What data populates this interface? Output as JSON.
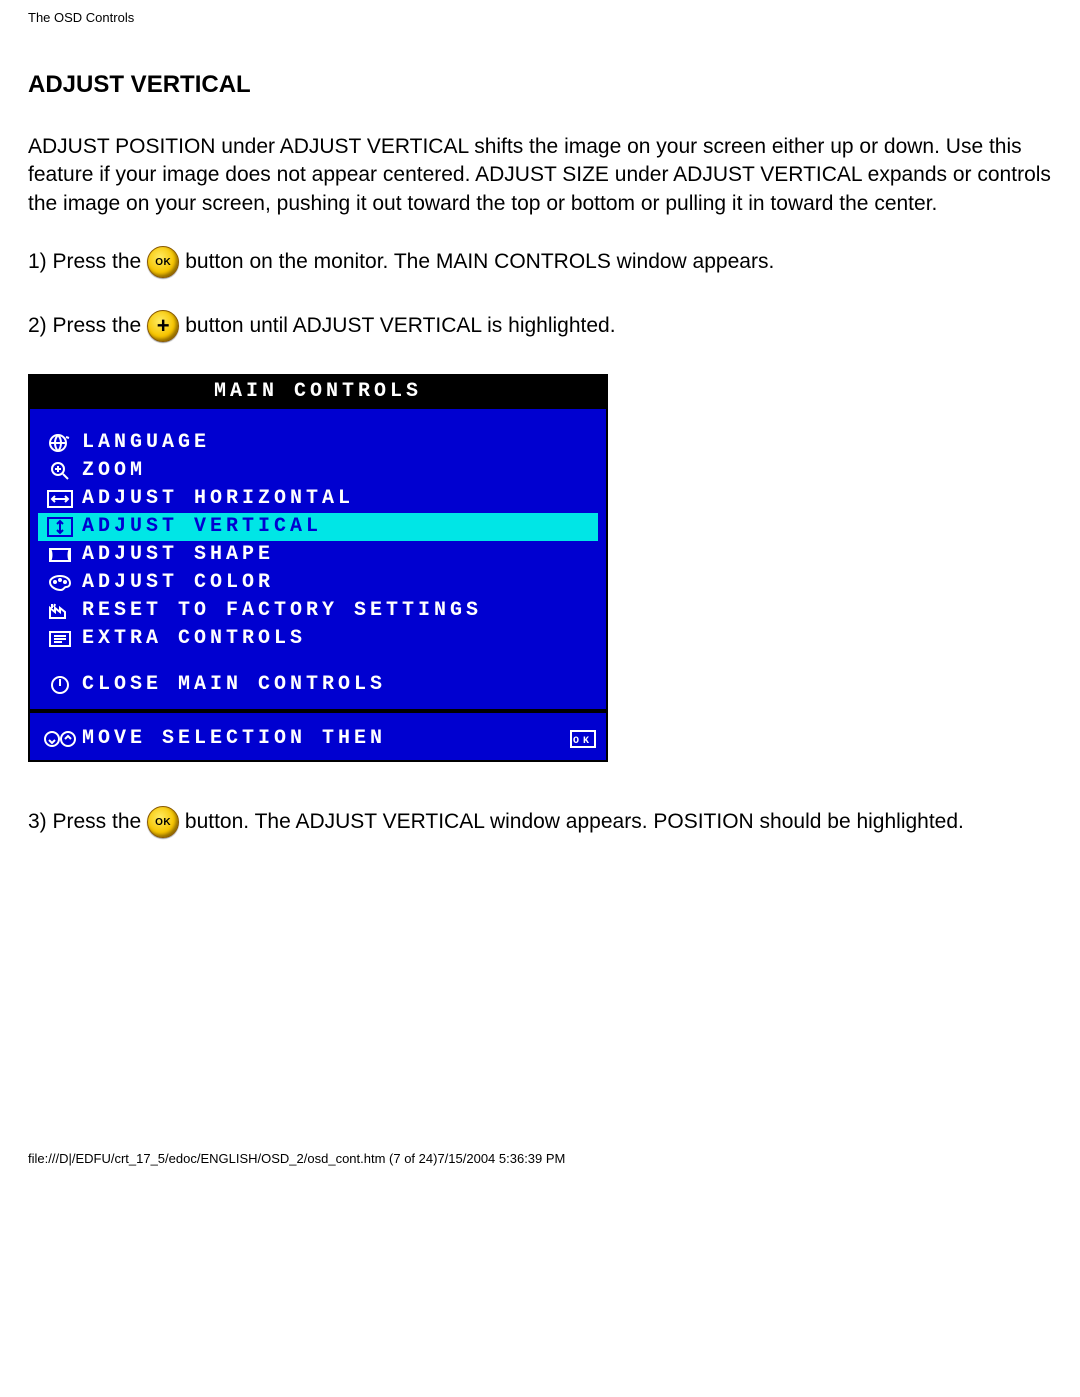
{
  "header": {
    "doc_title": "The OSD Controls"
  },
  "section": {
    "title": "ADJUST VERTICAL",
    "intro": "ADJUST POSITION under ADJUST VERTICAL shifts the image on your screen either up or down. Use this feature if your image does not appear centered. ADJUST SIZE under ADJUST VERTICAL expands or controls the image on your screen, pushing it out toward the top or bottom or pulling it in toward the center."
  },
  "steps": {
    "s1_a": "1) Press the ",
    "s1_b": " button on the monitor. The MAIN CONTROLS window appears.",
    "s2_a": "2) Press the ",
    "s2_b": " button until ADJUST VERTICAL is highlighted.",
    "s3_a": "3) Press the ",
    "s3_b": " button. The ADJUST VERTICAL window appears. POSITION should be highlighted."
  },
  "buttons": {
    "ok_label": "OK",
    "plus_label": "+"
  },
  "osd": {
    "title": "MAIN CONTROLS",
    "items": [
      {
        "label": "LANGUAGE",
        "icon": "globe",
        "highlighted": false
      },
      {
        "label": "ZOOM",
        "icon": "zoom",
        "highlighted": false
      },
      {
        "label": "ADJUST HORIZONTAL",
        "icon": "h-arrows",
        "highlighted": false
      },
      {
        "label": "ADJUST VERTICAL",
        "icon": "v-arrows-box",
        "highlighted": true
      },
      {
        "label": "ADJUST SHAPE",
        "icon": "shape",
        "highlighted": false
      },
      {
        "label": "ADJUST COLOR",
        "icon": "palette",
        "highlighted": false
      },
      {
        "label": "RESET TO FACTORY SETTINGS",
        "icon": "factory",
        "highlighted": false
      },
      {
        "label": "EXTRA CONTROLS",
        "icon": "list",
        "highlighted": false
      }
    ],
    "close_label": "CLOSE MAIN CONTROLS",
    "footer_label": "MOVE SELECTION THEN",
    "footer_end_icon_label": "OK"
  },
  "footer": {
    "path": "file:///D|/EDFU/crt_17_5/edoc/ENGLISH/OSD_2/osd_cont.htm (7 of 24)7/15/2004 5:36:39 PM"
  }
}
